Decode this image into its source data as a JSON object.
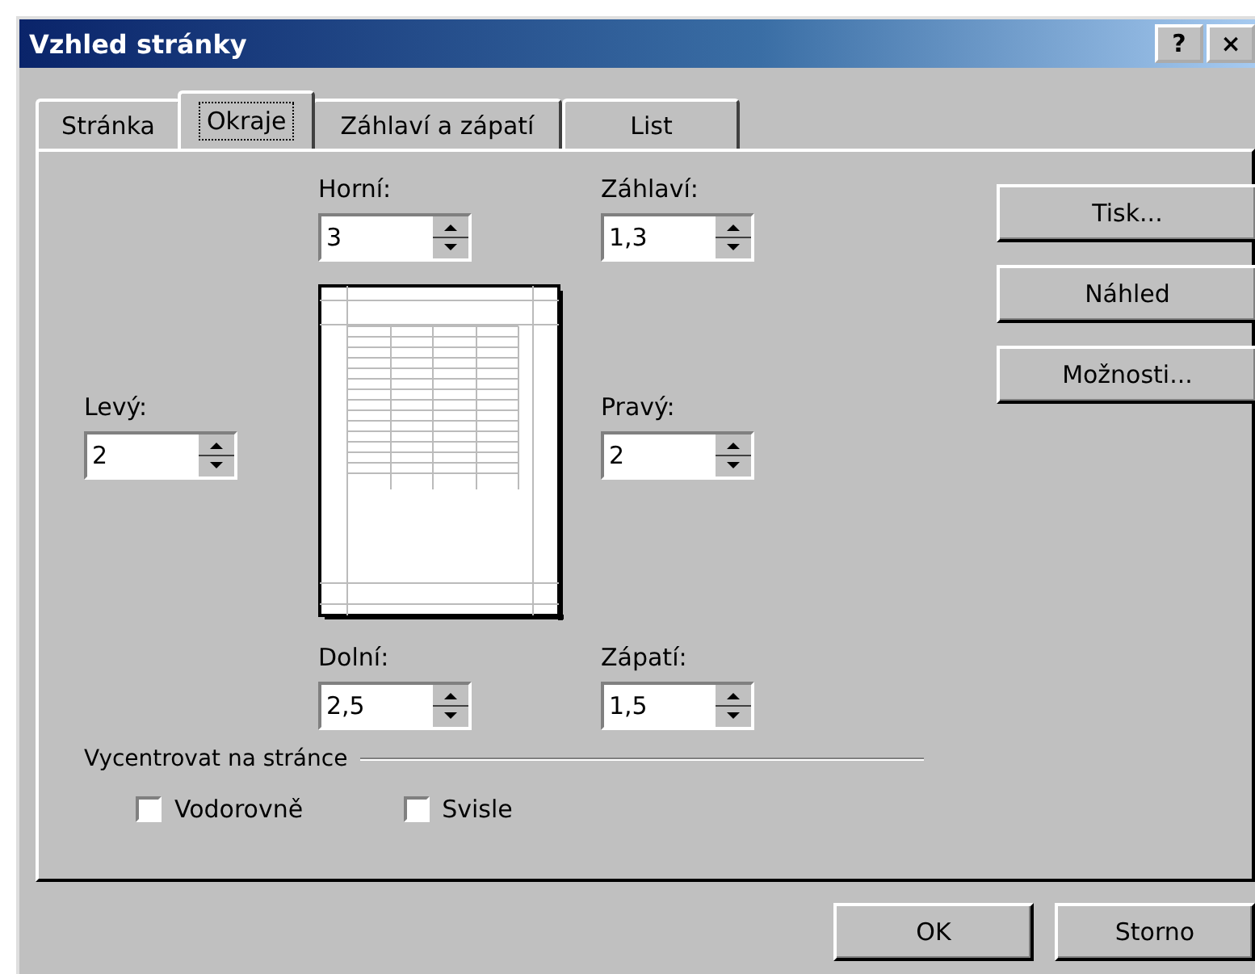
{
  "window": {
    "title": "Vzhled stránky",
    "help": "?",
    "close": "×"
  },
  "tabs": [
    {
      "label": "Stránka",
      "selected": false
    },
    {
      "label": "Okraje",
      "selected": true
    },
    {
      "label": "Záhlaví a zápatí",
      "selected": false
    },
    {
      "label": "List",
      "selected": false
    }
  ],
  "margins": {
    "top": {
      "label": "Horní:",
      "value": "3"
    },
    "header": {
      "label": "Záhlaví:",
      "value": "1,3"
    },
    "left": {
      "label": "Levý:",
      "value": "2"
    },
    "right": {
      "label": "Pravý:",
      "value": "2"
    },
    "bottom": {
      "label": "Dolní:",
      "value": "2,5"
    },
    "footer": {
      "label": "Zápatí:",
      "value": "1,5"
    }
  },
  "center": {
    "title": "Vycentrovat na stránce",
    "options": [
      {
        "label": "Vodorovně",
        "checked": false
      },
      {
        "label": "Svisle",
        "checked": false
      }
    ]
  },
  "side_buttons": [
    "Tisk...",
    "Náhled",
    "Možnosti..."
  ],
  "buttons": [
    "OK",
    "Storno"
  ]
}
